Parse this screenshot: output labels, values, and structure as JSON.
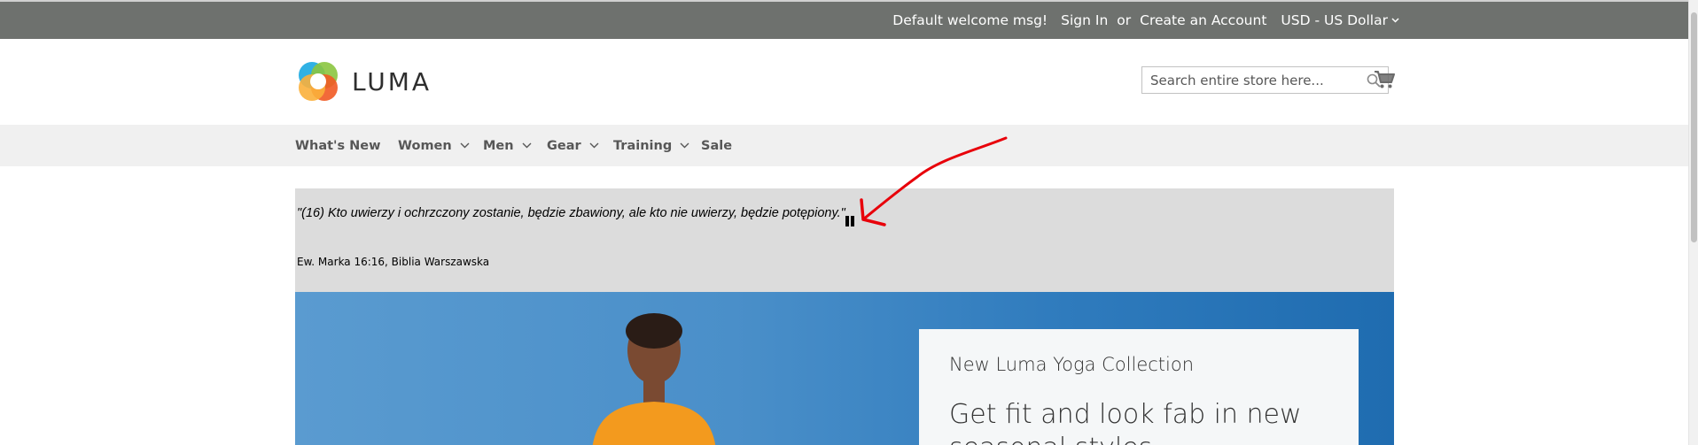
{
  "panel": {
    "welcome": "Default welcome msg!",
    "sign_in": "Sign In",
    "or": "or",
    "create_account": "Create an Account",
    "currency": "USD - US Dollar"
  },
  "header": {
    "logo_text": "LUMA",
    "search_placeholder": "Search entire store here...",
    "icons": [
      "search-icon",
      "cart-icon"
    ]
  },
  "nav": {
    "items": [
      {
        "label": "What's New",
        "has_menu": false
      },
      {
        "label": "Women",
        "has_menu": true
      },
      {
        "label": "Men",
        "has_menu": true
      },
      {
        "label": "Gear",
        "has_menu": true
      },
      {
        "label": "Training",
        "has_menu": true
      },
      {
        "label": "Sale",
        "has_menu": false
      }
    ]
  },
  "quote": {
    "text": "\"(16) Kto uwierzy i ochrzczony zostanie, będzie zbawiony, ale kto nie uwierzy, będzie potępiony.\"",
    "reference": "Ew. Marka 16:16, Biblia Warszawska",
    "control_icon": "pause-icon"
  },
  "hero": {
    "kicker": "New Luma Yoga Collection",
    "title": "Get fit and look fab in new seasonal styles"
  },
  "colors": {
    "panel_bg": "#6e716e",
    "nav_bg": "#f0f0f0",
    "quote_bg": "#dcdcdc",
    "annotation": "#e8000a"
  }
}
